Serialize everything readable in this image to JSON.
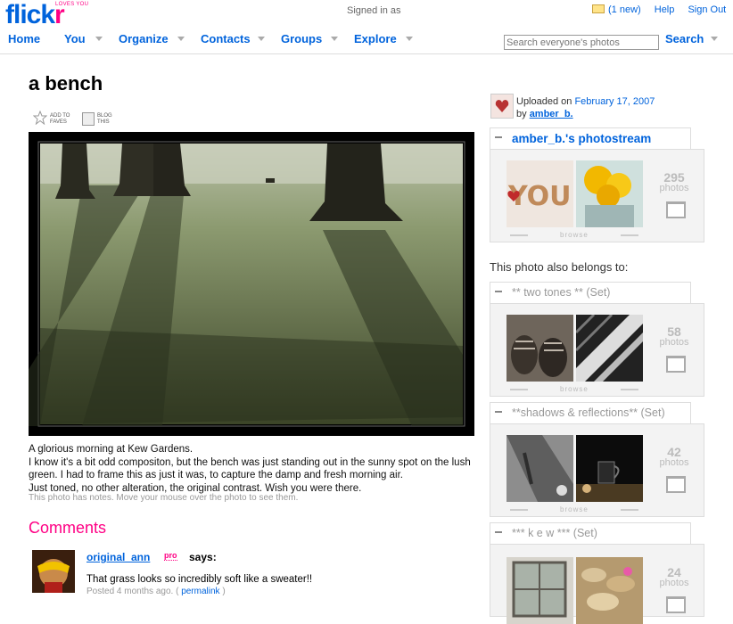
{
  "header": {
    "logo_text": "flickr",
    "logo_tagline": "LOVES YOU",
    "signed_in_as": "Signed in as",
    "new_messages": "(1 new)",
    "help": "Help",
    "sign_out": "Sign Out",
    "nav": [
      "Home",
      "You",
      "Organize",
      "Contacts",
      "Groups",
      "Explore"
    ],
    "search_placeholder": "Search everyone's photos",
    "search_button": "Search"
  },
  "photo_page": {
    "title": "a bench",
    "add_to_faves": "ADD TO FAVES",
    "blog_this": "BLOG THIS",
    "description": [
      "A glorious morning at Kew Gardens.",
      "I know it's a bit odd compositon, but the bench was just standing out in the sunny spot on the lush green. I had to frame this as just it was, to capture the damp and fresh morning air.",
      "Just toned, no other alteration, the original contrast. Wish you were there."
    ],
    "notes_hint": "This photo has notes. Move your mouse over the photo to see them."
  },
  "comments": {
    "heading": "Comments",
    "items": [
      {
        "user": "original_ann",
        "badge": "pro",
        "says": "says:",
        "text": "That grass looks so incredibly soft like a sweater!!",
        "posted": "Posted 4 months ago.",
        "permalink": "permalink"
      }
    ]
  },
  "sidebar": {
    "uploaded_label": "Uploaded on",
    "uploaded_date": "February 17, 2007",
    "by_label": "by",
    "uploader": "amber_b.",
    "photostream": {
      "title": "amber_b.'s photostream",
      "count": "295",
      "unit": "photos",
      "browse": "browse"
    },
    "belongs_label": "This photo also belongs to:",
    "sets": [
      {
        "title": "** two tones ** (Set)",
        "count": "58",
        "unit": "photos",
        "browse": "browse"
      },
      {
        "title": "**shadows & reflections** (Set)",
        "count": "42",
        "unit": "photos",
        "browse": "browse"
      },
      {
        "title": "*** k e w *** (Set)",
        "count": "24",
        "unit": "photos"
      }
    ]
  },
  "colors": {
    "brand_blue": "#0063dc",
    "brand_pink": "#ff0084"
  }
}
